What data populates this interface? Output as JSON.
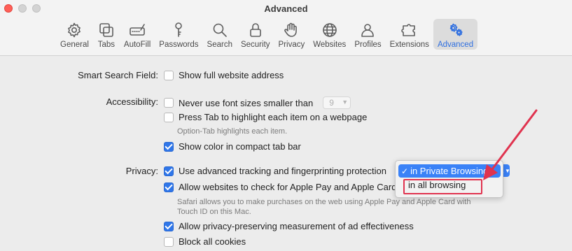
{
  "window": {
    "title": "Advanced"
  },
  "toolbar": {
    "tabs": [
      {
        "label": "General",
        "icon": "gear-icon"
      },
      {
        "label": "Tabs",
        "icon": "tabs-icon"
      },
      {
        "label": "AutoFill",
        "icon": "autofill-icon"
      },
      {
        "label": "Passwords",
        "icon": "key-icon"
      },
      {
        "label": "Search",
        "icon": "search-icon"
      },
      {
        "label": "Security",
        "icon": "lock-icon"
      },
      {
        "label": "Privacy",
        "icon": "hand-icon"
      },
      {
        "label": "Websites",
        "icon": "globe-icon"
      },
      {
        "label": "Profiles",
        "icon": "person-icon"
      },
      {
        "label": "Extensions",
        "icon": "extensions-icon"
      },
      {
        "label": "Advanced",
        "icon": "gears-icon",
        "active": true
      }
    ]
  },
  "smart_search": {
    "label": "Smart Search Field:",
    "option": {
      "text": "Show full website address",
      "checked": false
    }
  },
  "accessibility": {
    "label": "Accessibility:",
    "font_option": {
      "text": "Never use font sizes smaller than",
      "checked": false
    },
    "font_size_value": "9",
    "tab_option": {
      "text": "Press Tab to highlight each item on a webpage",
      "checked": false
    },
    "tab_hint": "Option-Tab highlights each item.",
    "color_option": {
      "text": "Show color in compact tab bar",
      "checked": true
    }
  },
  "privacy": {
    "label": "Privacy:",
    "tracking_option": {
      "text": "Use advanced tracking and fingerprinting protection",
      "checked": true
    },
    "applepay_option": {
      "text": "Allow websites to check for Apple Pay and Apple Card",
      "checked": true
    },
    "applepay_hint_line1": "Safari allows you to make purchases on the web using Apple Pay and Apple Card with",
    "applepay_hint_line2": "Touch ID on this Mac.",
    "measurement_option": {
      "text": "Allow privacy-preserving measurement of ad effectiveness",
      "checked": true
    },
    "cookies_option": {
      "text": "Block all cookies",
      "checked": false
    }
  },
  "popup_menu": {
    "checkmark": "✓",
    "selected_option": "in Private Browsing",
    "other_option": "in all browsing"
  },
  "colors": {
    "accent": "#2f76e9",
    "highlight_box": "#e0334f"
  }
}
